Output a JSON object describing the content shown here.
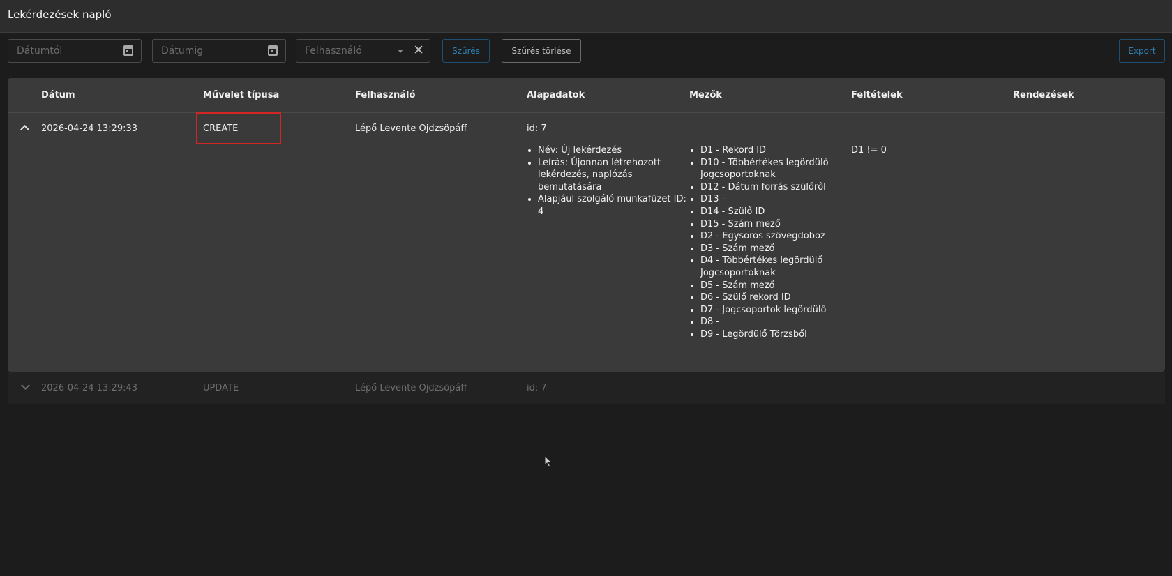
{
  "header": {
    "title": "Lekérdezések napló"
  },
  "filters": {
    "date_from_placeholder": "Dátumtól",
    "date_to_placeholder": "Dátumig",
    "user_placeholder": "Felhasználó",
    "filter_label": "Szűrés",
    "clear_label": "Szűrés törlése",
    "export_label": "Export"
  },
  "table": {
    "columns": [
      "Dátum",
      "Művelet típusa",
      "Felhasználó",
      "Alapadatok",
      "Mezők",
      "Feltételek",
      "Rendezések"
    ],
    "rows": [
      {
        "date": "2026-04-24 13:29:33",
        "operation": "CREATE",
        "user": "Lépő Levente Ojdzsöpáff",
        "base": "id: 7",
        "expanded": true,
        "details": {
          "base_items": [
            "Név: Új lekérdezés",
            "Leírás: Újonnan létrehozott lekérdezés, naplózás bemutatására",
            "Alapjául szolgáló munkafüzet ID: 4"
          ],
          "field_items": [
            "D1 - Rekord ID",
            "D10 - Többértékes legördülő Jogcsoportoknak",
            "D12 - Dátum forrás szülőről",
            "D13 -",
            "D14 - Szülő ID",
            "D15 - Szám mező",
            "D2 - Egysoros szövegdoboz",
            "D3 - Szám mező",
            "D4 - Többértékes legördülő Jogcsoportoknak",
            "D5 - Szám mező",
            "D6 - Szülő rekord ID",
            "D7 - Jogcsoportok legördülő",
            "D8 -",
            "D9 - Legördülő Törzsből"
          ],
          "conditions": "D1 != 0"
        }
      },
      {
        "date": "2026-04-24 13:29:43",
        "operation": "UPDATE",
        "user": "Lépő Levente Ojdzsöpáff",
        "base": "id: 7",
        "expanded": false
      }
    ]
  }
}
